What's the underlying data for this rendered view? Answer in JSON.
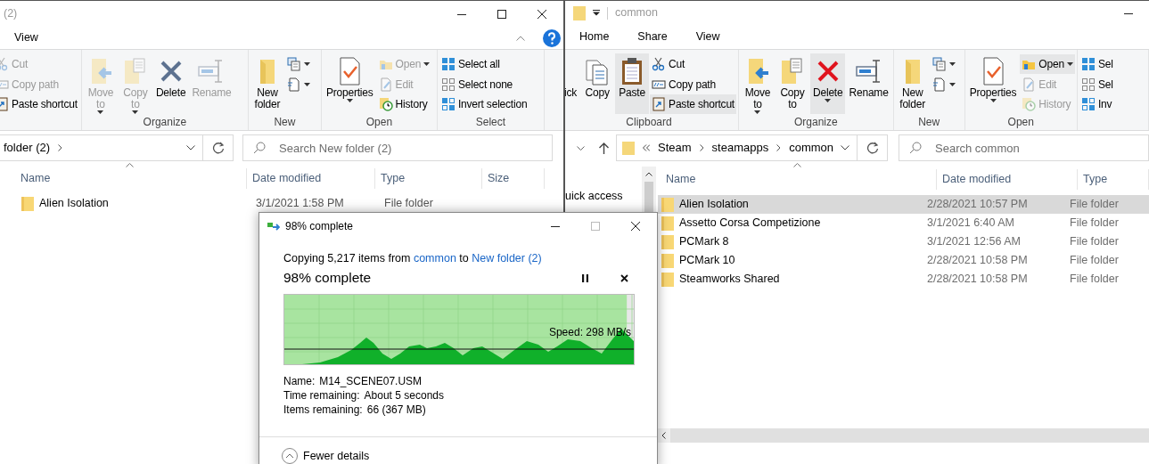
{
  "left_window": {
    "title": "(2)",
    "tabs": [
      {
        "label": "View",
        "selected": false
      }
    ],
    "ribbon": [
      {
        "items": [
          {
            "kind": "small",
            "label": "Cut",
            "disabled": true,
            "menu": false,
            "highlighted": false
          },
          {
            "kind": "small",
            "label": "Copy path",
            "disabled": true,
            "menu": false,
            "highlighted": false
          },
          {
            "kind": "small",
            "label": "Paste shortcut",
            "disabled": false,
            "menu": false,
            "highlighted": false
          }
        ]
      },
      {
        "label": "Organize",
        "items": [
          {
            "kind": "large",
            "label": "Move to",
            "disabled": true,
            "menu": true,
            "highlighted": false
          },
          {
            "kind": "large",
            "label": "Copy to",
            "disabled": true,
            "menu": true,
            "highlighted": false
          },
          {
            "kind": "large",
            "label": "Delete",
            "disabled": false,
            "menu": false,
            "highlighted": false
          },
          {
            "kind": "large",
            "label": "Rename",
            "disabled": true,
            "menu": false,
            "highlighted": false
          }
        ]
      },
      {
        "label": "New",
        "items": [
          {
            "kind": "large",
            "label": "New folder",
            "disabled": false,
            "menu": false,
            "highlighted": false
          },
          {
            "kind": "icon",
            "disabled": false,
            "menu": true,
            "highlighted": false
          },
          {
            "kind": "icon",
            "disabled": false,
            "menu": true,
            "highlighted": false
          }
        ]
      },
      {
        "label": "Open",
        "items": [
          {
            "kind": "large",
            "label": "Properties",
            "disabled": false,
            "menu": true,
            "highlighted": false
          },
          {
            "kind": "small",
            "label": "Open",
            "disabled": true,
            "menu": true,
            "highlighted": false
          },
          {
            "kind": "small",
            "label": "Edit",
            "disabled": true,
            "menu": false,
            "highlighted": false
          },
          {
            "kind": "small",
            "label": "History",
            "disabled": false,
            "menu": false,
            "highlighted": false
          }
        ]
      },
      {
        "label": "Select",
        "items": [
          {
            "kind": "small",
            "label": "Select all",
            "disabled": false,
            "menu": false,
            "highlighted": false
          },
          {
            "kind": "small",
            "label": "Select none",
            "disabled": false,
            "menu": false,
            "highlighted": false
          },
          {
            "kind": "small",
            "label": "Invert selection",
            "disabled": false,
            "menu": false,
            "highlighted": false
          }
        ]
      }
    ],
    "address": {
      "segments": [
        "folder (2)"
      ]
    },
    "search": {
      "placeholder": "Search New folder (2)"
    },
    "columns": [
      "Name",
      "Date modified",
      "Type",
      "Size"
    ],
    "rows": [
      {
        "name": "Alien Isolation",
        "date": "3/1/2021 1:58 PM",
        "type": "File folder",
        "selected": false
      }
    ]
  },
  "right_window": {
    "title": "common",
    "tabs": [
      {
        "label": "Home",
        "selected": false
      },
      {
        "label": "Share",
        "selected": false
      },
      {
        "label": "View",
        "selected": false
      }
    ],
    "ribbon": [
      {
        "label": "Clipboard",
        "items": [
          {
            "kind": "large",
            "label": "ick",
            "disabled": false,
            "menu": false,
            "highlighted": false
          },
          {
            "kind": "large",
            "label": "Copy",
            "disabled": false,
            "menu": false,
            "highlighted": false
          },
          {
            "kind": "large",
            "label": "Paste",
            "disabled": false,
            "menu": false,
            "highlighted": true
          },
          {
            "kind": "small",
            "label": "Cut",
            "disabled": false,
            "menu": false,
            "highlighted": false
          },
          {
            "kind": "small",
            "label": "Copy path",
            "disabled": false,
            "menu": false,
            "highlighted": false
          },
          {
            "kind": "small",
            "label": "Paste shortcut",
            "disabled": false,
            "menu": false,
            "highlighted": true
          }
        ]
      },
      {
        "label": "Organize",
        "items": [
          {
            "kind": "large",
            "label": "Move to",
            "disabled": false,
            "menu": true,
            "highlighted": false
          },
          {
            "kind": "large",
            "label": "Copy to",
            "disabled": false,
            "menu": false,
            "highlighted": false
          },
          {
            "kind": "large",
            "label": "Delete",
            "disabled": false,
            "menu": true,
            "highlighted": true
          },
          {
            "kind": "large",
            "label": "Rename",
            "disabled": false,
            "menu": false,
            "highlighted": false
          }
        ]
      },
      {
        "label": "New",
        "items": [
          {
            "kind": "large",
            "label": "New folder",
            "disabled": false,
            "menu": false,
            "highlighted": false
          },
          {
            "kind": "icon",
            "disabled": false,
            "menu": true,
            "highlighted": false
          },
          {
            "kind": "icon",
            "disabled": false,
            "menu": true,
            "highlighted": false
          }
        ]
      },
      {
        "label": "Open",
        "items": [
          {
            "kind": "large",
            "label": "Properties",
            "disabled": false,
            "menu": true,
            "highlighted": false
          },
          {
            "kind": "small",
            "label": "Open",
            "disabled": false,
            "menu": true,
            "highlighted": true
          },
          {
            "kind": "small",
            "label": "Edit",
            "disabled": true,
            "menu": false,
            "highlighted": false
          },
          {
            "kind": "small",
            "label": "History",
            "disabled": true,
            "menu": false,
            "highlighted": false
          }
        ]
      },
      {
        "items": [
          {
            "kind": "small",
            "label": "Sel",
            "disabled": false,
            "menu": false,
            "highlighted": false
          },
          {
            "kind": "small",
            "label": "Sel",
            "disabled": false,
            "menu": false,
            "highlighted": false
          },
          {
            "kind": "small",
            "label": "Inv",
            "disabled": false,
            "menu": false,
            "highlighted": false
          }
        ]
      }
    ],
    "address": {
      "segments": [
        "Steam",
        "steamapps",
        "common"
      ]
    },
    "search": {
      "placeholder": "Search common"
    },
    "nav": [
      "uick access"
    ],
    "columns": [
      "Name",
      "Date modified",
      "Type"
    ],
    "rows": [
      {
        "name": "Alien Isolation",
        "date": "2/28/2021 10:57 PM",
        "type": "File folder",
        "selected": true
      },
      {
        "name": "Assetto Corsa Competizione",
        "date": "3/1/2021 6:40 AM",
        "type": "File folder",
        "selected": false
      },
      {
        "name": "PCMark 8",
        "date": "3/1/2021 12:56 AM",
        "type": "File folder",
        "selected": false
      },
      {
        "name": "PCMark 10",
        "date": "2/28/2021 10:58 PM",
        "type": "File folder",
        "selected": false
      },
      {
        "name": "Steamworks Shared",
        "date": "2/28/2021 10:58 PM",
        "type": "File folder",
        "selected": false
      }
    ]
  },
  "dialog": {
    "title": "98% complete",
    "copying": {
      "prefix": "Copying 5,217 items from",
      "source": "common",
      "middle": "to",
      "destination": "New folder (2)"
    },
    "heading": "98% complete",
    "level": 0.98,
    "speed": "Speed: 298 MB/s",
    "details": [
      {
        "label": "Name:",
        "value": "M14_SCENE07.USM"
      },
      {
        "label": "Time remaining:",
        "value": "About 5 seconds"
      },
      {
        "label": "Items remaining:",
        "value": "66 (367 MB)"
      }
    ],
    "toggle": "Fewer details"
  }
}
